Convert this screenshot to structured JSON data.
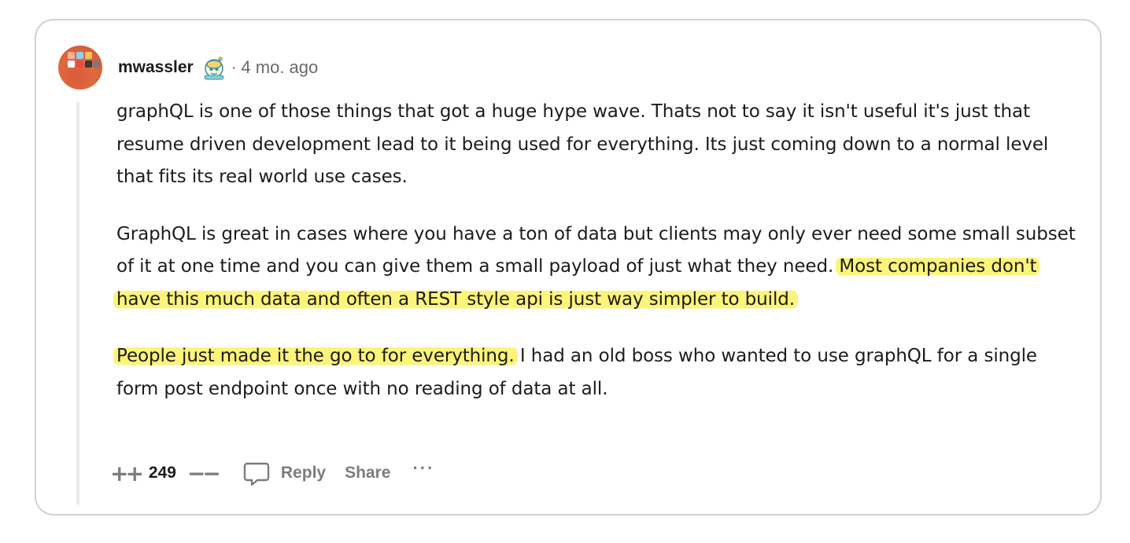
{
  "comment": {
    "author": "mwassler",
    "separator": "·",
    "timestamp": "4 mo. ago",
    "paragraphs": {
      "p1": "graphQL is one of those things that got a huge hype wave. Thats not to say it isn't useful it's just that resume driven development lead to it being used for everything. Its just coming down to a normal level that fits its real world use cases.",
      "p2_plain": "GraphQL is great in cases where you have a ton of data but clients may only ever need some small subset of it at one time and you can give them a small payload of just what they need.",
      "p2_highlight": "Most companies don't have this much data and often a REST style api is just way simpler to build.",
      "p3_highlight": "People just made it the go to for everything.",
      "p3_plain": "I had an old boss who wanted to use graphQL for a single form post endpoint once with no reading of data at all."
    },
    "highlight_color": "#fdf47a"
  },
  "actions": {
    "upvote_icon": "upvote-icon",
    "upvote_glyph": "++",
    "vote_count": "249",
    "downvote_icon": "downvote-icon",
    "downvote_glyph": "−−",
    "reply_label": "Reply",
    "share_label": "Share",
    "more_glyph": "···"
  }
}
